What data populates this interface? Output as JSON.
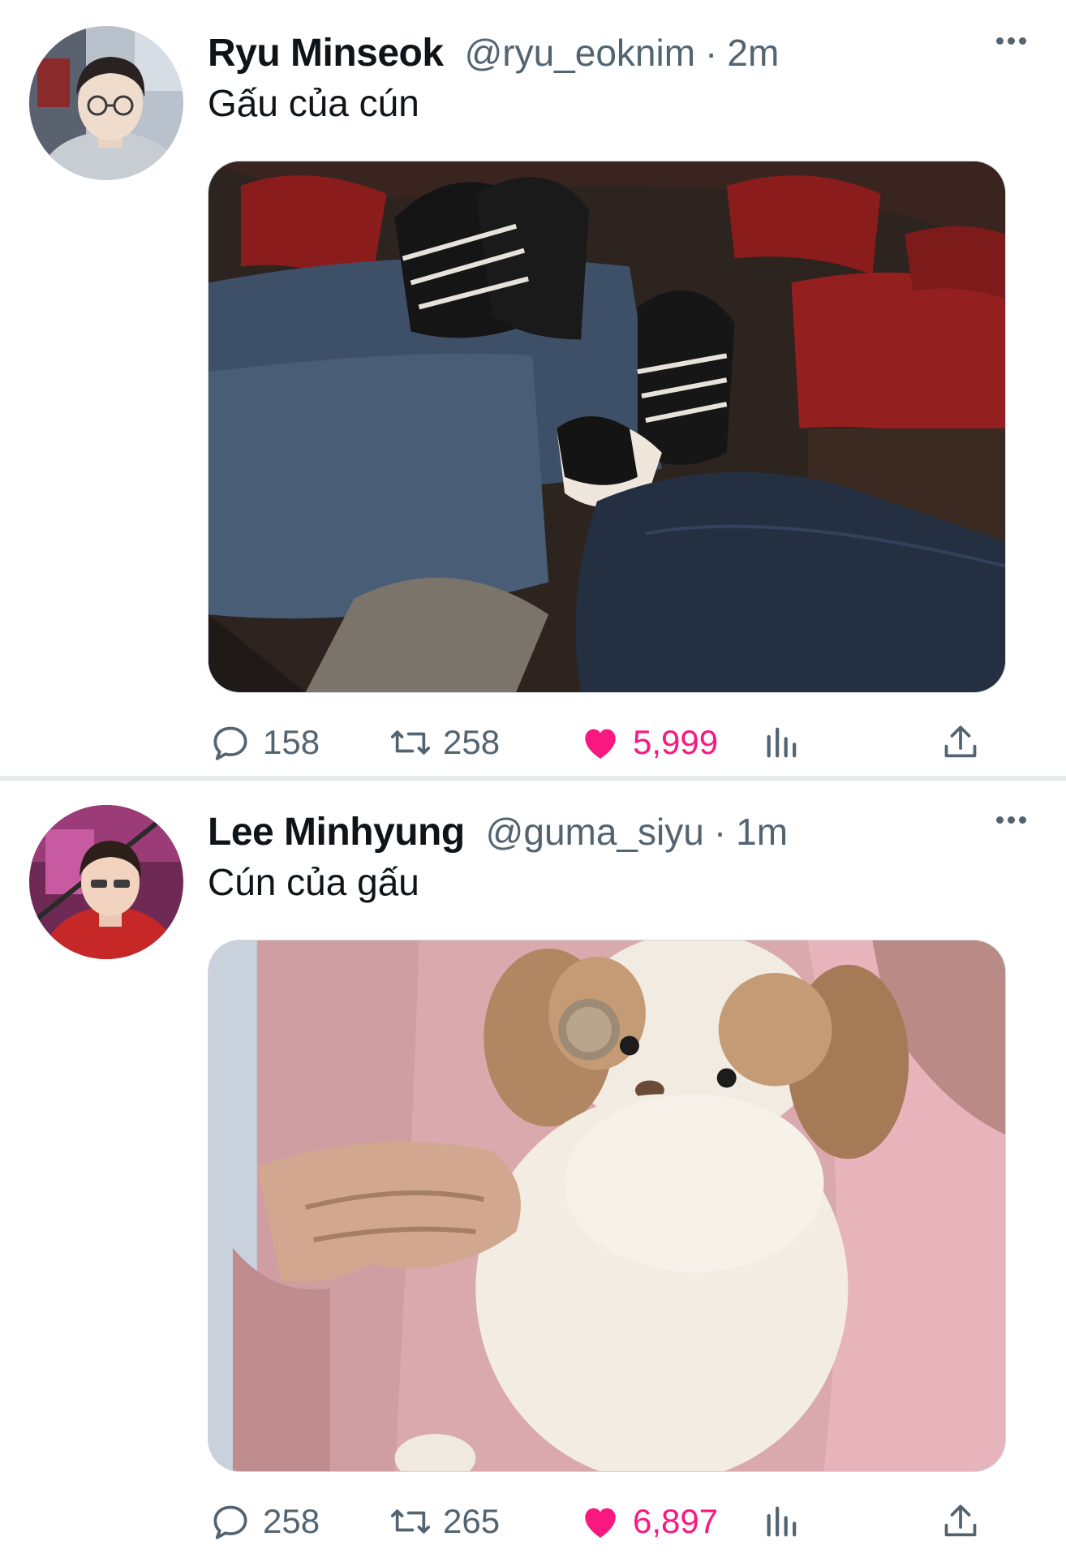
{
  "tweets": [
    {
      "author_name": "Ryu Minseok",
      "handle": "@ryu_eoknim",
      "separator": "·",
      "time": "2m",
      "text": "Gấu của cún",
      "avatar": "avatar-photo",
      "media": "photo-sneakers-in-theater",
      "replies": "158",
      "retweets": "258",
      "likes": "5,999",
      "liked": true
    },
    {
      "author_name": "Lee Minhyung",
      "handle": "@guma_siyu",
      "separator": "·",
      "time": "1m",
      "text": "Cún của gấu",
      "avatar": "avatar-photo",
      "media": "photo-plush-puppy",
      "replies": "258",
      "retweets": "265",
      "likes": "6,897",
      "liked": true
    }
  ],
  "icons": {
    "reply": "reply-icon",
    "retweet": "retweet-icon",
    "like": "heart-icon",
    "views": "views-icon",
    "share": "share-icon",
    "more": "more-icon"
  },
  "colors": {
    "like_active": "#f91880",
    "muted_text": "#536471",
    "primary_text": "#0f1419",
    "divider": "#e7e9ea"
  }
}
